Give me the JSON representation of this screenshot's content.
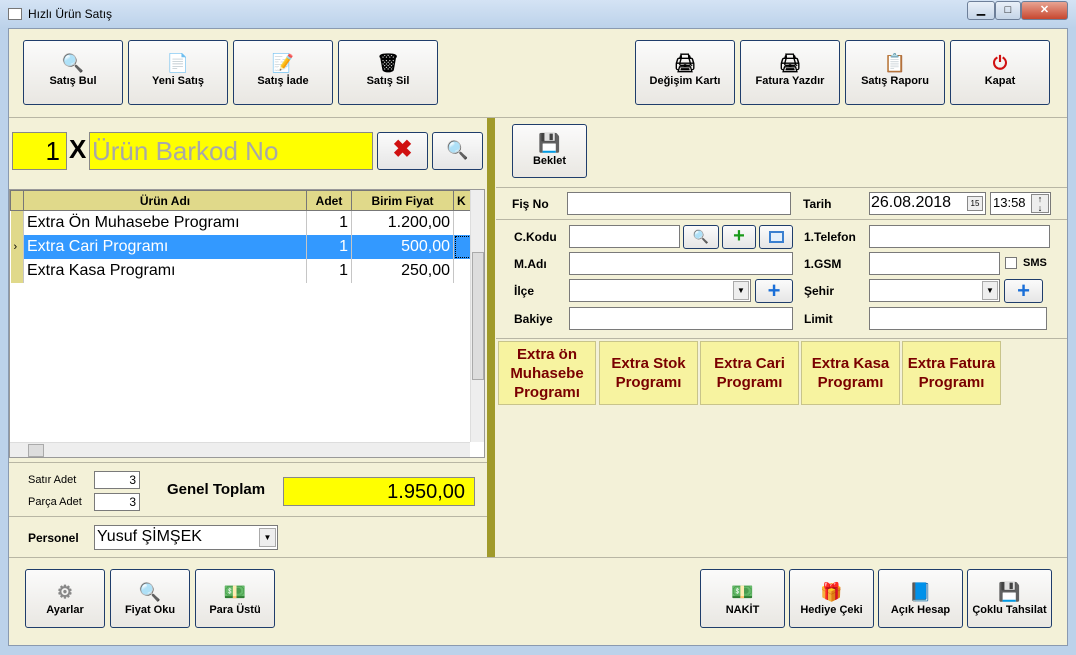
{
  "window": {
    "title": "Hızlı Ürün Satış",
    "min": "▁",
    "max": "□",
    "close": "✕"
  },
  "toolbar": {
    "left": [
      {
        "label": "Satış Bul",
        "icon": "search-icon"
      },
      {
        "label": "Yeni Satış",
        "icon": "new-document-icon"
      },
      {
        "label": "Satış İade",
        "icon": "edit-icon"
      },
      {
        "label": "Satış Sil",
        "icon": "trash-icon"
      }
    ],
    "right": [
      {
        "label": "Değişim Kartı",
        "icon": "printer-icon"
      },
      {
        "label": "Fatura Yazdır",
        "icon": "printer-icon"
      },
      {
        "label": "Satış Raporu",
        "icon": "report-icon"
      },
      {
        "label": "Kapat",
        "icon": "power-icon"
      }
    ]
  },
  "barcode": {
    "quantity": "1",
    "multiplier": "X",
    "placeholder": "Ürün Barkod No"
  },
  "grid": {
    "headers": [
      "Ürün Adı",
      "Adet",
      "Birim Fiyat",
      "K"
    ],
    "rows": [
      {
        "name": "Extra Ön Muhasebe Programı",
        "qty": "1",
        "price": "1.200,00"
      },
      {
        "name": "Extra Cari Programı",
        "qty": "1",
        "price": "500,00",
        "selected": true
      },
      {
        "name": "Extra Kasa Programı",
        "qty": "1",
        "price": "250,00"
      }
    ]
  },
  "summary": {
    "row_count_label": "Satır Adet",
    "row_count": "3",
    "piece_count_label": "Parça Adet",
    "piece_count": "3",
    "total_label": "Genel Toplam",
    "total": "1.950,00"
  },
  "staff": {
    "label": "Personel",
    "value": "Yusuf ŞİMŞEK"
  },
  "bottom_left": [
    {
      "label": "Ayarlar",
      "icon": "gear-icon"
    },
    {
      "label": "Fiyat Oku",
      "icon": "search-icon"
    },
    {
      "label": "Para Üstü",
      "icon": "money-icon"
    }
  ],
  "bottom_right": [
    {
      "label": "NAKİT",
      "icon": "cash-icon"
    },
    {
      "label": "Hediye Çeki",
      "icon": "gift-icon"
    },
    {
      "label": "Açık Hesap",
      "icon": "book-icon"
    },
    {
      "label": "Çoklu Tahsilat",
      "icon": "save-icon"
    }
  ],
  "hold": {
    "label": "Beklet"
  },
  "form": {
    "receipt_no_label": "Fiş No",
    "receipt_no": "",
    "date_label": "Tarih",
    "date": "26.08.2018",
    "time": "13:58",
    "customer_code_label": "C.Kodu",
    "customer_name_label": "M.Adı",
    "district_label": "İlçe",
    "balance_label": "Bakiye",
    "phone_label": "1.Telefon",
    "gsm_label": "1.GSM",
    "sms_label": "SMS",
    "city_label": "Şehir",
    "limit_label": "Limit"
  },
  "products": [
    "Extra ön Muhasebe Programı",
    "Extra Stok Programı",
    "Extra Cari Programı",
    "Extra Kasa Programı",
    "Extra Fatura Programı"
  ],
  "colors": {
    "background": "#f3f1d8",
    "highlight_yellow": "#ffff00",
    "selection": "#3399ff",
    "product_text": "#7a0000",
    "divider": "#a09a2a"
  }
}
